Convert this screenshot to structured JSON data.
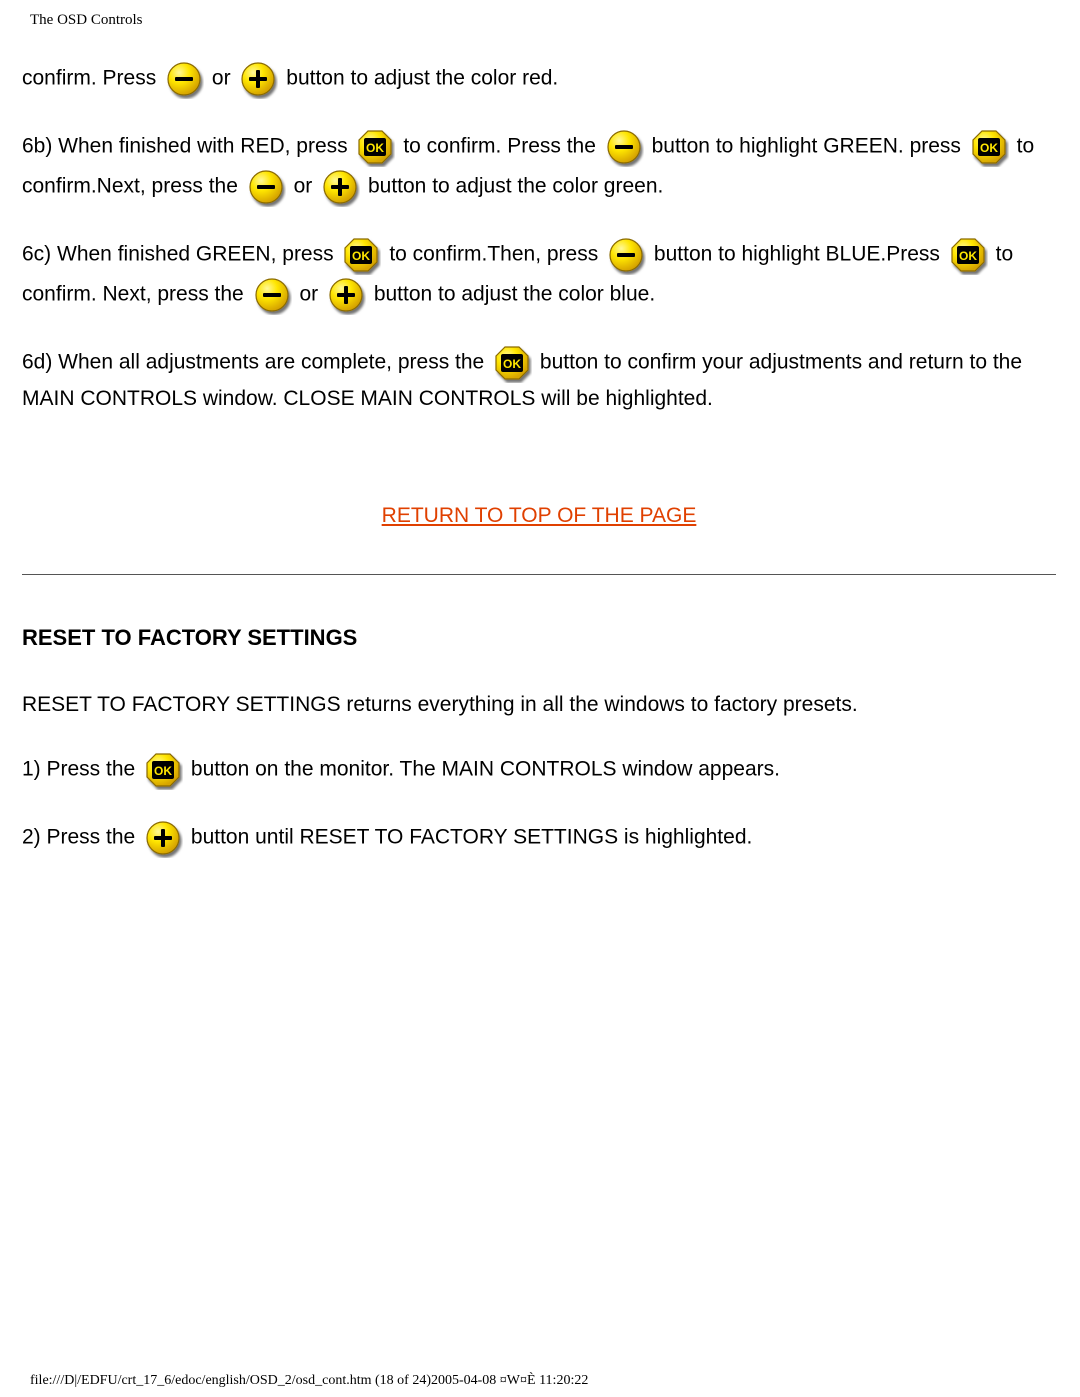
{
  "header": {
    "title": "The OSD Controls"
  },
  "paras": {
    "p1": {
      "s1": "confirm. Press",
      "s2": "or",
      "s3": "button to adjust the color red."
    },
    "p2": {
      "s1": "6b) When finished with RED, press",
      "s2": "to confirm. Press the",
      "s3": "button to highlight GREEN. press",
      "s4": "to confirm.Next, press the",
      "s5": "or",
      "s6": "button to adjust the color green."
    },
    "p3": {
      "s1": "6c) When finished GREEN, press",
      "s2": "to confirm.Then, press",
      "s3": "button to highlight BLUE.Press",
      "s4": "to confirm. Next, press the",
      "s5": "or",
      "s6": "button to adjust the color blue."
    },
    "p4": {
      "s1": "6d) When all adjustments are complete, press the",
      "s2": "button to confirm your adjustments and return to the MAIN CONTROLS window. CLOSE MAIN CONTROLS will be highlighted."
    }
  },
  "link": {
    "return_top": "RETURN TO TOP OF THE PAGE"
  },
  "section": {
    "heading": "RESET TO FACTORY SETTINGS"
  },
  "reset": {
    "intro": "RESET TO FACTORY SETTINGS returns everything in all the windows to factory presets.",
    "step1a": "1) Press the",
    "step1b": "button on the monitor. The MAIN CONTROLS window appears.",
    "step2a": "2) Press the",
    "step2b": "button until RESET TO FACTORY SETTINGS is highlighted."
  },
  "footer": {
    "text": "file:///D|/EDFU/crt_17_6/edoc/english/OSD_2/osd_cont.htm (18 of 24)2005-04-08 ¤W¤È 11:20:22"
  }
}
